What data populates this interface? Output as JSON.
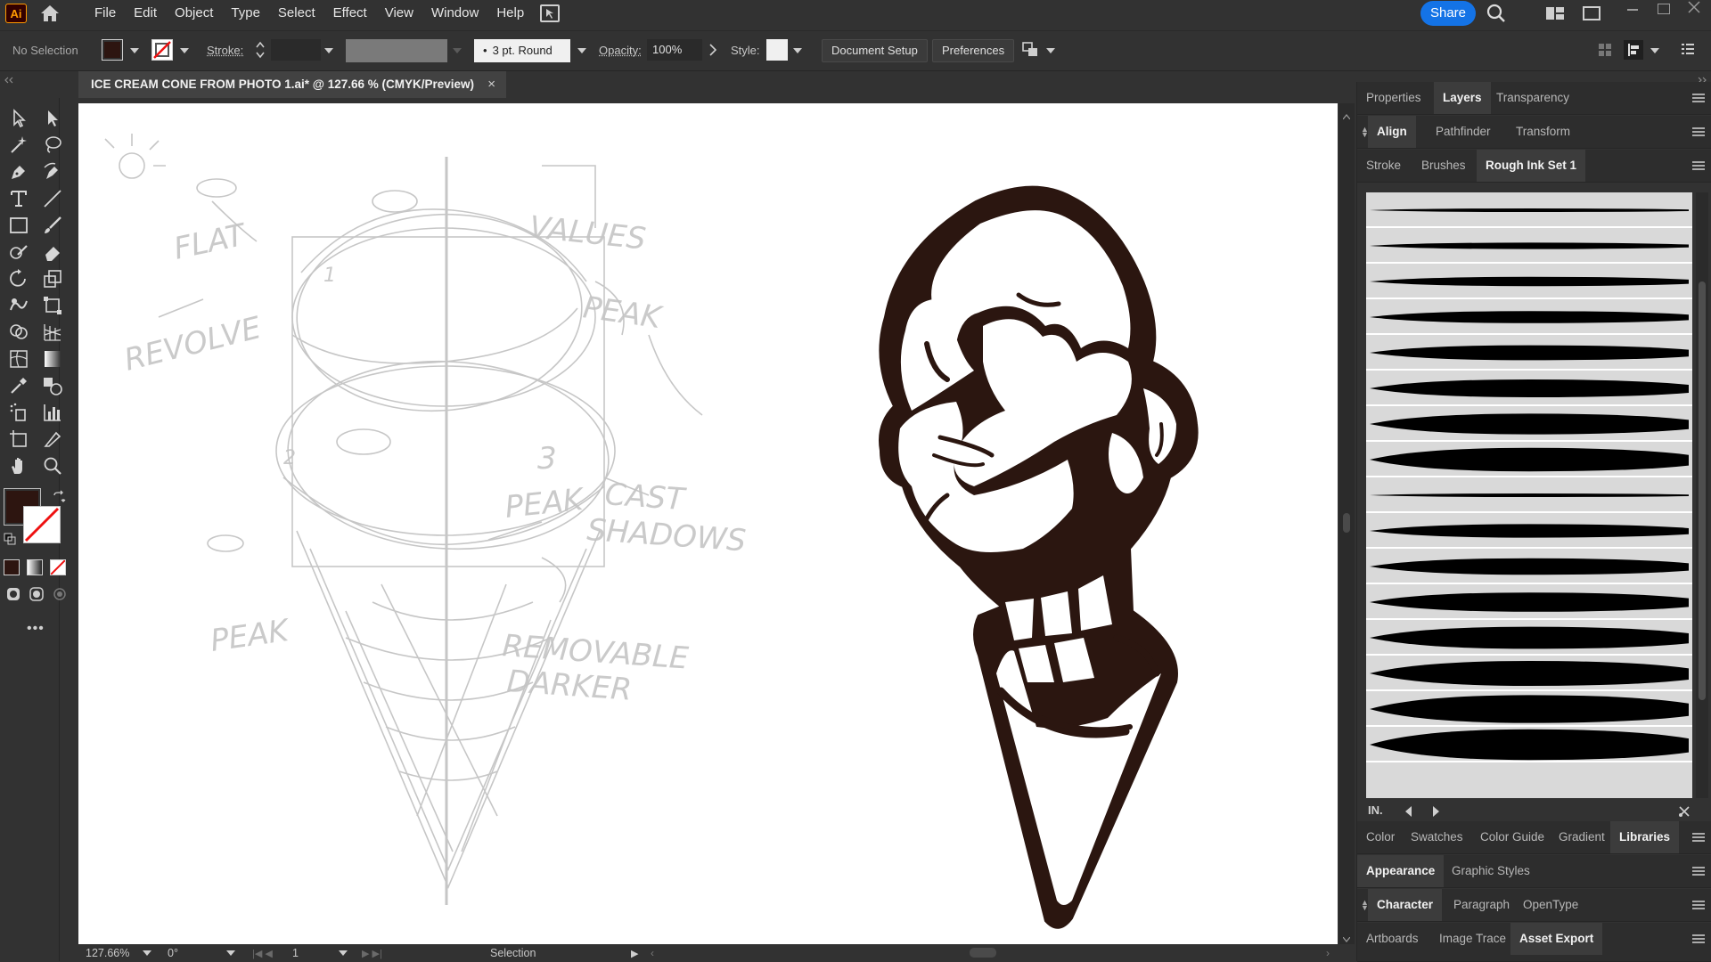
{
  "app": {
    "logo": "Ai",
    "menu": [
      "File",
      "Edit",
      "Object",
      "Type",
      "Select",
      "Effect",
      "View",
      "Window",
      "Help"
    ],
    "share_label": "Share"
  },
  "control_bar": {
    "selection": "No Selection",
    "stroke_label": "Stroke:",
    "brush_value": "3 pt. Round",
    "opacity_label": "Opacity:",
    "opacity_value": "100%",
    "style_label": "Style:",
    "document_setup": "Document Setup",
    "preferences": "Preferences"
  },
  "document": {
    "tab_title": "ICE CREAM CONE FROM PHOTO 1.ai* @ 127.66 % (CMYK/Preview)",
    "close": "×"
  },
  "colors": {
    "fill": "#2d1510",
    "ink": "#2b1610",
    "accent": "#1473e6"
  },
  "sketch_notes": [
    "FLAT",
    "VALUES",
    "PEAK",
    "REVOLVE",
    "3",
    "CAST",
    "SHADOWS",
    "PEAK",
    "PEAK",
    "REMOVABLE",
    "DARKER",
    "2",
    "1"
  ],
  "status": {
    "zoom": "127.66%",
    "rotation": "0°",
    "artboard": "1",
    "tool": "Selection"
  },
  "panels": {
    "row1": [
      "Properties",
      "Layers",
      "Transparency"
    ],
    "row1_active": 1,
    "row2": [
      "Align",
      "Pathfinder",
      "Transform"
    ],
    "row2_active": 0,
    "row3": [
      "Stroke",
      "Brushes",
      "Rough Ink Set 1"
    ],
    "row3_active": 2,
    "row4": [
      "Color",
      "Swatches",
      "Color Guide",
      "Gradient",
      "Libraries"
    ],
    "row4_active": 4,
    "row5": [
      "Appearance",
      "Graphic Styles"
    ],
    "row5_active": 0,
    "row6": [
      "Character",
      "Paragraph",
      "OpenType"
    ],
    "row6_active": 0,
    "row7": [
      "Artboards",
      "Image Trace",
      "Asset Export"
    ],
    "row7_active": 2
  },
  "brush_count": 16
}
